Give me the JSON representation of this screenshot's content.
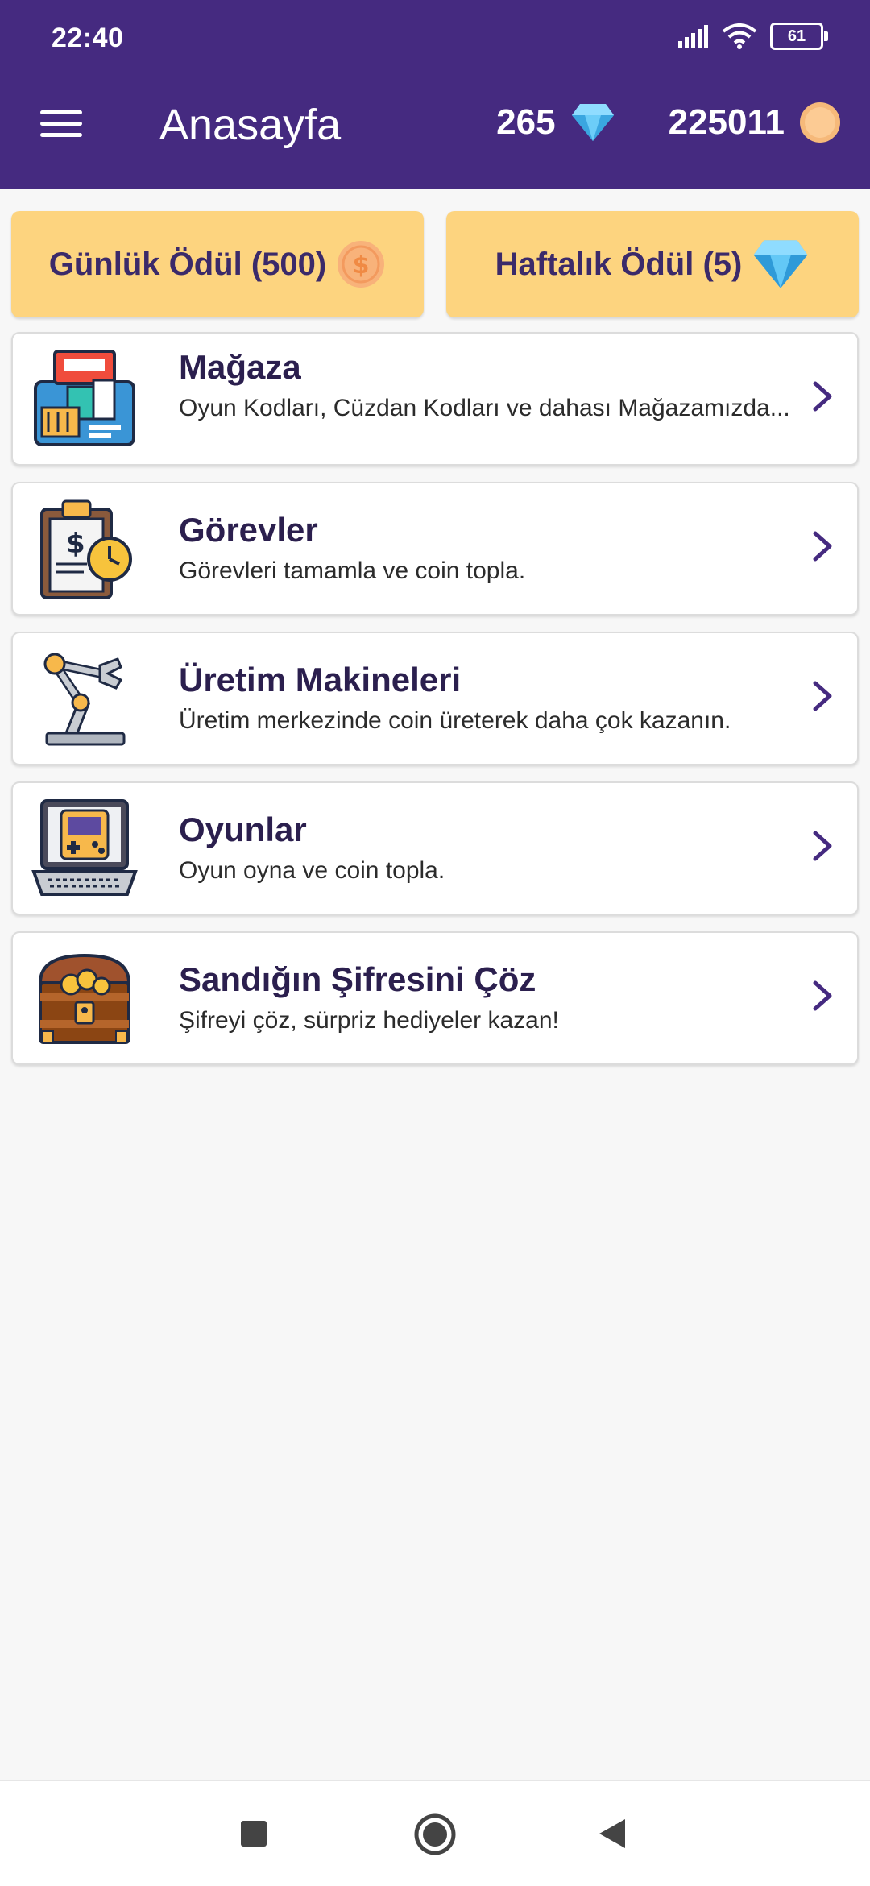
{
  "status_bar": {
    "time": "22:40",
    "battery": "61"
  },
  "header": {
    "title": "Anasayfa",
    "diamonds": "265",
    "coins": "225011"
  },
  "rewards": {
    "daily_label": "Günlük Ödül (500)",
    "weekly_label": "Haftalık Ödül (5)"
  },
  "menu_items": [
    {
      "title": "Mağaza",
      "description": "Oyun Kodları, Cüzdan Kodları ve dahası Mağazamızda...",
      "icon": "store-icon"
    },
    {
      "title": "Görevler",
      "description": "Görevleri tamamla ve coin topla.",
      "icon": "task-clipboard-icon"
    },
    {
      "title": "Üretim Makineleri",
      "description": "Üretim merkezinde coin üreterek daha çok kazanın.",
      "icon": "robot-arm-icon"
    },
    {
      "title": "Oyunlar",
      "description": "Oyun oyna ve coin topla.",
      "icon": "laptop-game-icon"
    },
    {
      "title": "Sandığın Şifresini Çöz",
      "description": "Şifreyi çöz, sürpriz hediyeler kazan!",
      "icon": "treasure-chest-icon"
    }
  ],
  "colors": {
    "header_bg": "#452a80",
    "reward_bg": "#fdd47f",
    "chevron": "#452a80"
  }
}
